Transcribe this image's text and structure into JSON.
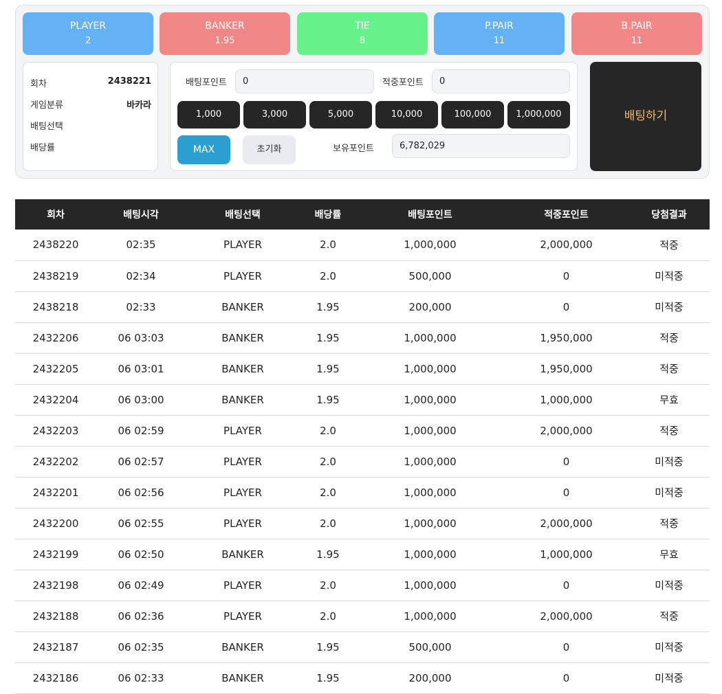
{
  "bet_options": [
    {
      "name": "PLAYER",
      "odds": "2",
      "color": "#64b1f3"
    },
    {
      "name": "BANKER",
      "odds": "1.95",
      "color": "#f28787"
    },
    {
      "name": "TIE",
      "odds": "8",
      "color": "#66f18a"
    },
    {
      "name": "P.PAIR",
      "odds": "11",
      "color": "#64b1f3"
    },
    {
      "name": "B.PAIR",
      "odds": "11",
      "color": "#f28787"
    }
  ],
  "info": {
    "round_label": "회차",
    "round_value": "2438221",
    "game_label": "게임분류",
    "game_value": "바카라",
    "selection_label": "배팅선택",
    "selection_value": "",
    "odds_label": "배당률",
    "odds_value": ""
  },
  "controls": {
    "bet_points_label": "배팅포인트",
    "bet_points_value": "0",
    "win_points_label": "적중포인트",
    "win_points_value": "0",
    "chips": [
      "1,000",
      "3,000",
      "5,000",
      "10,000",
      "100,000",
      "1,000,000"
    ],
    "max_label": "MAX",
    "reset_label": "초기화",
    "holding_label": "보유포인트",
    "holding_value": "6,782,029"
  },
  "place_bet_label": "배팅하기",
  "colors": {
    "accent_blue": "#2b9fd1",
    "dark": "#262626",
    "gold": "#f0b96a"
  },
  "history": {
    "headers": [
      "회차",
      "배팅시각",
      "배팅선택",
      "배당률",
      "배팅포인트",
      "적중포인트",
      "당첨결과"
    ],
    "rows": [
      [
        "2438220",
        "02:35",
        "PLAYER",
        "2.0",
        "1,000,000",
        "2,000,000",
        "적중"
      ],
      [
        "2438219",
        "02:34",
        "PLAYER",
        "2.0",
        "500,000",
        "0",
        "미적중"
      ],
      [
        "2438218",
        "02:33",
        "BANKER",
        "1.95",
        "200,000",
        "0",
        "미적중"
      ],
      [
        "2432206",
        "06 03:03",
        "BANKER",
        "1.95",
        "1,000,000",
        "1,950,000",
        "적중"
      ],
      [
        "2432205",
        "06 03:01",
        "BANKER",
        "1.95",
        "1,000,000",
        "1,950,000",
        "적중"
      ],
      [
        "2432204",
        "06 03:00",
        "BANKER",
        "1.95",
        "1,000,000",
        "1,000,000",
        "무효"
      ],
      [
        "2432203",
        "06 02:59",
        "PLAYER",
        "2.0",
        "1,000,000",
        "2,000,000",
        "적중"
      ],
      [
        "2432202",
        "06 02:57",
        "PLAYER",
        "2.0",
        "1,000,000",
        "0",
        "미적중"
      ],
      [
        "2432201",
        "06 02:56",
        "PLAYER",
        "2.0",
        "1,000,000",
        "0",
        "미적중"
      ],
      [
        "2432200",
        "06 02:55",
        "PLAYER",
        "2.0",
        "1,000,000",
        "2,000,000",
        "적중"
      ],
      [
        "2432199",
        "06 02:50",
        "BANKER",
        "1.95",
        "1,000,000",
        "1,000,000",
        "무효"
      ],
      [
        "2432198",
        "06 02:49",
        "PLAYER",
        "2.0",
        "1,000,000",
        "0",
        "미적중"
      ],
      [
        "2432188",
        "06 02:36",
        "PLAYER",
        "2.0",
        "1,000,000",
        "2,000,000",
        "적중"
      ],
      [
        "2432187",
        "06 02:35",
        "BANKER",
        "1.95",
        "500,000",
        "0",
        "미적중"
      ],
      [
        "2432186",
        "06 02:33",
        "BANKER",
        "1.95",
        "200,000",
        "0",
        "미적중"
      ]
    ]
  }
}
